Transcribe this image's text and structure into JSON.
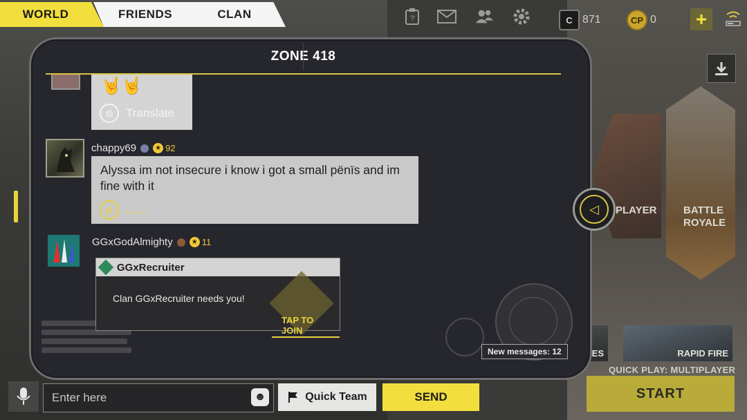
{
  "tabs": [
    {
      "label": "WORLD",
      "active": true
    },
    {
      "label": "FRIENDS",
      "active": false
    },
    {
      "label": "CLAN",
      "active": false
    }
  ],
  "topbar": {
    "icons": [
      "clipboard-icon",
      "mail-icon",
      "friends-icon",
      "gear-icon"
    ],
    "cod_points": {
      "symbol": "C",
      "value": "871"
    },
    "cp": {
      "symbol": "CP",
      "value": "0"
    },
    "plus": "+"
  },
  "chat": {
    "title": "ZONE 418",
    "messages": [
      {
        "emoji": "🤘🤘",
        "translate_label": "Translate"
      },
      {
        "username": "chappy69",
        "level": "92",
        "text": "Alyssa im not insecure i know i got a small pënïs and im fine with it",
        "translating": "......"
      },
      {
        "username": "GGxGodAlmighty",
        "level": "11",
        "clan_card": {
          "clan_name": "GGxRecruiter",
          "message": "Clan GGxRecruiter needs you!",
          "action": "TAP TO JOIN"
        }
      }
    ],
    "new_messages": "New messages: 12"
  },
  "input": {
    "placeholder": "Enter here",
    "quick_team": "Quick Team",
    "send": "SEND"
  },
  "modes": {
    "multiplayer": "PLAYER",
    "battle_royale": "BATTLE ROYALE",
    "zombies": "ZOMBIES",
    "rapid_fire": "RAPID FIRE",
    "quick_play": "QUICK PLAY: MULTIPLAYER",
    "start": "START"
  },
  "colors": {
    "accent_yellow": "#f2df3d",
    "panel_bg": "#26262d",
    "bubble_bg": "#c9c9c9"
  }
}
